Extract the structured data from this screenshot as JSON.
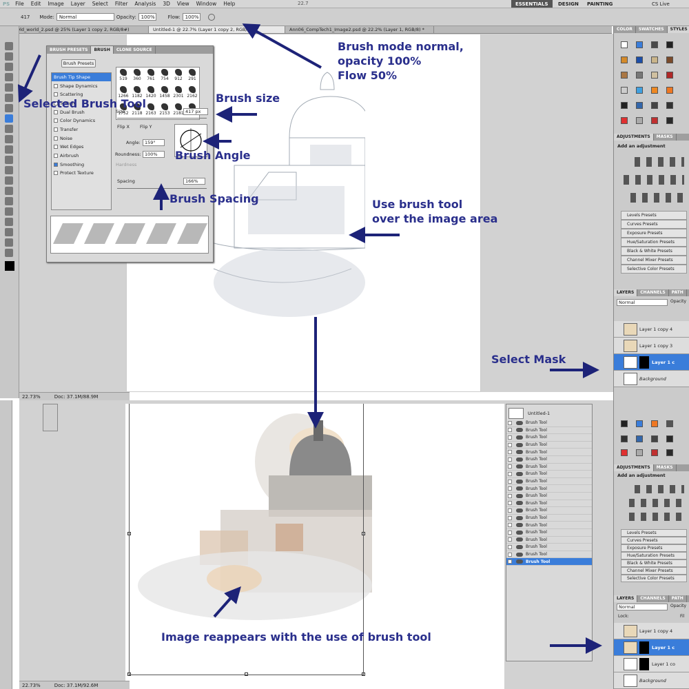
{
  "menubar": {
    "app_badge": "PS",
    "items": [
      "File",
      "Edit",
      "Image",
      "Layer",
      "Select",
      "Filter",
      "Analysis",
      "3D",
      "View",
      "Window",
      "Help"
    ],
    "zoom": "22.7",
    "workspaces": [
      "ESSENTIALS",
      "DESIGN",
      "PAINTING"
    ],
    "cs_live": "CS Live"
  },
  "options": {
    "brush_size": "417",
    "mode_label": "Mode:",
    "mode_value": "Normal",
    "opacity_label": "Opacity:",
    "opacity_value": "100%",
    "flow_label": "Flow:",
    "flow_value": "100%"
  },
  "doc_tabs": [
    "Old_world_2.psd @ 25% (Layer 1 copy 2, RGB/8#)",
    "Untitled-1 @ 22.7% (Layer 1 copy 2, RGB/8) *",
    "Ann06_CompTech1_Image2.psd @ 22.2% (Layer 1, RGB/8) *"
  ],
  "brush_panel": {
    "tabs": [
      "BRUSH PRESETS",
      "BRUSH",
      "CLONE SOURCE"
    ],
    "presets_button": "Brush Presets",
    "items": [
      "Brush Tip Shape",
      "Shape Dynamics",
      "Scattering",
      "Texture",
      "Dual Brush",
      "Color Dynamics",
      "Transfer",
      "Noise",
      "Wet Edges",
      "Airbrush",
      "Smoothing",
      "Protect Texture"
    ],
    "tip_sizes": [
      "519",
      "360",
      "761",
      "754",
      "912",
      "291",
      "1266",
      "1182",
      "1420",
      "1458",
      "2301",
      "2162",
      "1752",
      "2118",
      "2163",
      "2153",
      "2181",
      "2172"
    ],
    "size_label": "Size",
    "size_value": "417 px",
    "flipx": "Flip X",
    "flipy": "Flip Y",
    "angle_label": "Angle:",
    "angle_value": "159°",
    "roundness_label": "Roundness:",
    "roundness_value": "100%",
    "hardness_label": "Hardness",
    "spacing_label": "Spacing",
    "spacing_value": "166%"
  },
  "status": {
    "zoom1": "22.73%",
    "doc1": "Doc: 37.1M/88.9M",
    "zoom2": "22.73%",
    "doc2": "Doc: 37.1M/92.6M"
  },
  "right_panels": {
    "swatch_tabs": [
      "COLOR",
      "SWATCHES",
      "STYLES"
    ],
    "adj_tabs": [
      "ADJUSTMENTS",
      "MASKS"
    ],
    "adj_title": "Add an adjustment",
    "presets": [
      "Levels Presets",
      "Curves Presets",
      "Exposure Presets",
      "Hue/Saturation Presets",
      "Black & White Presets",
      "Channel Mixer Presets",
      "Selective Color Presets"
    ],
    "layer_tabs": [
      "LAYERS",
      "CHANNELS",
      "PATH"
    ],
    "blend": "Normal",
    "opacity_abbrev": "Opacity",
    "lock": "Lock:",
    "fill_abbrev": "Fil",
    "layers_top": [
      "Layer 1 copy 4",
      "Layer 1 copy 3",
      "Layer 1 c",
      "Background"
    ],
    "layers_bottom": [
      "Layer 1 copy 4",
      "Layer 1 c",
      "Layer 1 co",
      "Background"
    ]
  },
  "history": {
    "doc_name": "Untitled-1",
    "item_label": "Brush Tool",
    "item_count": 20
  },
  "annotations": {
    "brush_mode": [
      "Brush mode normal,",
      "opacity 100%",
      "Flow 50%"
    ],
    "selected_tool": "Selected Brush Tool",
    "brush_size": "Brush size",
    "brush_angle": "Brush Angle",
    "brush_spacing": "Brush Spacing",
    "use_brush": [
      "Use brush tool",
      "over the image area"
    ],
    "select_mask": "Select Mask",
    "reappears": "Image reappears with the use of brush tool"
  },
  "colors": {
    "annotation": "#2a2f8c",
    "selection": "#3a7dda"
  }
}
